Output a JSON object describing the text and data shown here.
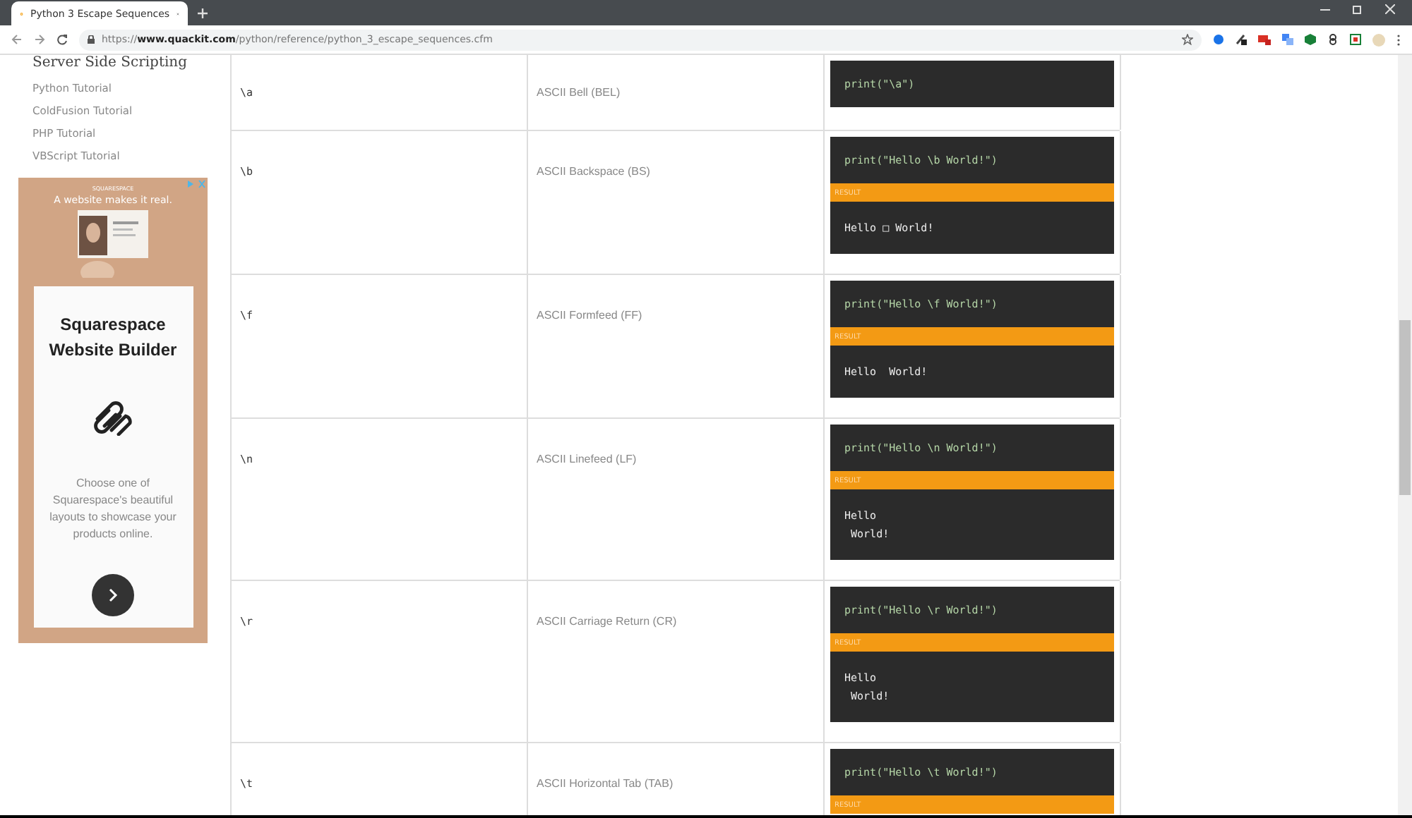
{
  "browser": {
    "tab": {
      "title": "Python 3 Escape Sequences",
      "selected": true
    },
    "url": {
      "scheme": "https://",
      "host": "www.quackit.com",
      "path": "/python/reference/python_3_escape_sequences.cfm"
    }
  },
  "sidebar": {
    "heading": "Server Side Scripting",
    "links": [
      "Python Tutorial",
      "ColdFusion Tutorial",
      "PHP Tutorial",
      "VBScript Tutorial"
    ]
  },
  "ad": {
    "brand": "SQUARESPACE",
    "tagline": "A website makes it real.",
    "title": "Squarespace Website Builder",
    "body": "Choose one of Squarespace's beautiful layouts to showcase your products online."
  },
  "table": {
    "rows": [
      {
        "sequence": "\\a",
        "meaning": "ASCII Bell (BEL)",
        "code": "print(\"\\a\")"
      },
      {
        "sequence": "\\b",
        "meaning": "ASCII Backspace (BS)",
        "code": "print(\"Hello \\b World!\")",
        "result_label": "RESULT",
        "output": "Hello □ World!"
      },
      {
        "sequence": "\\f",
        "meaning": "ASCII Formfeed (FF)",
        "code": "print(\"Hello \\f World!\")",
        "result_label": "RESULT",
        "output": "Hello  World!"
      },
      {
        "sequence": "\\n",
        "meaning": "ASCII Linefeed (LF)",
        "code": "print(\"Hello \\n World!\")",
        "result_label": "RESULT",
        "output": "Hello\n World!"
      },
      {
        "sequence": "\\r",
        "meaning": "ASCII Carriage Return (CR)",
        "code": "print(\"Hello \\r World!\")",
        "result_label": "RESULT",
        "output": "Hello\n World!"
      },
      {
        "sequence": "\\t",
        "meaning": "ASCII Horizontal Tab (TAB)",
        "code": "print(\"Hello \\t World!\")",
        "result_label": "RESULT"
      }
    ]
  }
}
